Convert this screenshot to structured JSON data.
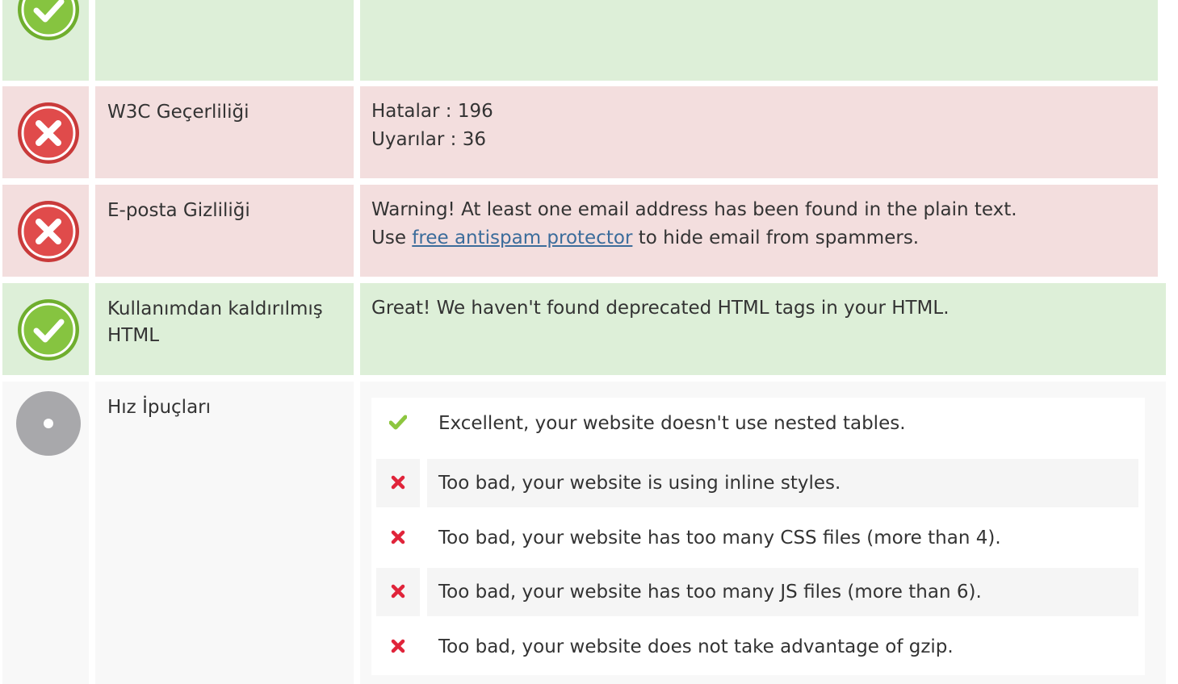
{
  "rows": [
    {
      "status": "pass",
      "icon": "check-circle-icon",
      "label": "",
      "value_lines": []
    },
    {
      "status": "fail",
      "icon": "x-circle-icon",
      "label": "W3C Geçerliliği",
      "value_lines": [
        "Hatalar : 196",
        "Uyarılar : 36"
      ]
    },
    {
      "status": "fail",
      "icon": "x-circle-icon",
      "label": "E-posta Gizliliği",
      "value": {
        "line1": "Warning! At least one email address has been found in the plain text.",
        "line2_before": "Use ",
        "link_text": "free antispam protector",
        "line2_after": " to hide email from spammers."
      }
    },
    {
      "status": "pass",
      "icon": "check-circle-icon",
      "label": "Kullanımdan kaldırılmış HTML",
      "value": "Great! We haven't found deprecated HTML tags in your HTML."
    },
    {
      "status": "info",
      "icon": "neutral-circle-icon",
      "label": "Hız İpuçları",
      "tips": [
        {
          "status": "pass",
          "icon": "checkmark-icon",
          "text": "Excellent, your website doesn't use nested tables."
        },
        {
          "status": "fail",
          "icon": "cross-icon",
          "text": "Too bad, your website is using inline styles."
        },
        {
          "status": "fail",
          "icon": "cross-icon",
          "text": "Too bad, your website has too many CSS files (more than 4)."
        },
        {
          "status": "fail",
          "icon": "cross-icon",
          "text": "Too bad, your website has too many JS files (more than 6)."
        },
        {
          "status": "fail",
          "icon": "cross-icon",
          "text": "Too bad, your website does not take advantage of gzip."
        }
      ]
    }
  ],
  "colors": {
    "pass_bg": "#ddefd8",
    "fail_bg": "#f3dede",
    "info_bg": "#f8f8f8",
    "pass_icon": "#7cc241",
    "fail_icon": "#d64545",
    "link": "#3b6c9b"
  }
}
